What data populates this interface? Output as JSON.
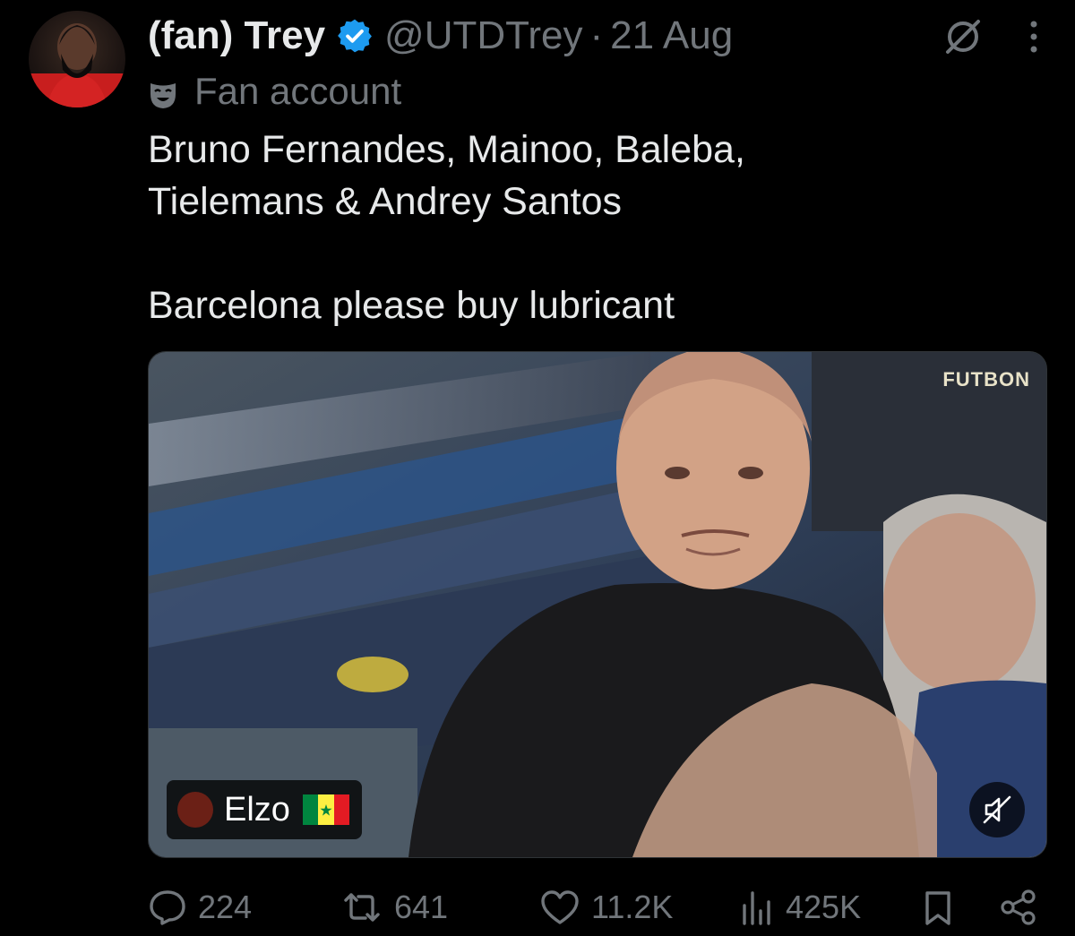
{
  "tweet": {
    "author_name": "(fan) Trey",
    "handle": "@UTDTrey",
    "separator": "·",
    "timestamp": "21 Aug",
    "label": "Fan account",
    "text_line1": "Bruno Fernandes, Mainoo, Baleba,",
    "text_line2": "Tielemans & Andrey Santos",
    "text_line3": "Barcelona please buy lubricant",
    "verified_color": "#1d9bf0"
  },
  "media": {
    "watermark": "FUTBON",
    "user_tag": "Elzo",
    "flag_colors": [
      "#00853f",
      "#fdef42",
      "#e31b23"
    ],
    "muted": true
  },
  "actions": {
    "replies": "224",
    "reposts": "641",
    "likes": "11.2K",
    "views": "425K"
  },
  "icons": [
    "verified-badge-icon",
    "grok-icon",
    "more-icon",
    "fan-mask-icon",
    "mute-icon",
    "reply-icon",
    "repost-icon",
    "like-icon",
    "views-icon",
    "bookmark-icon",
    "share-icon"
  ]
}
